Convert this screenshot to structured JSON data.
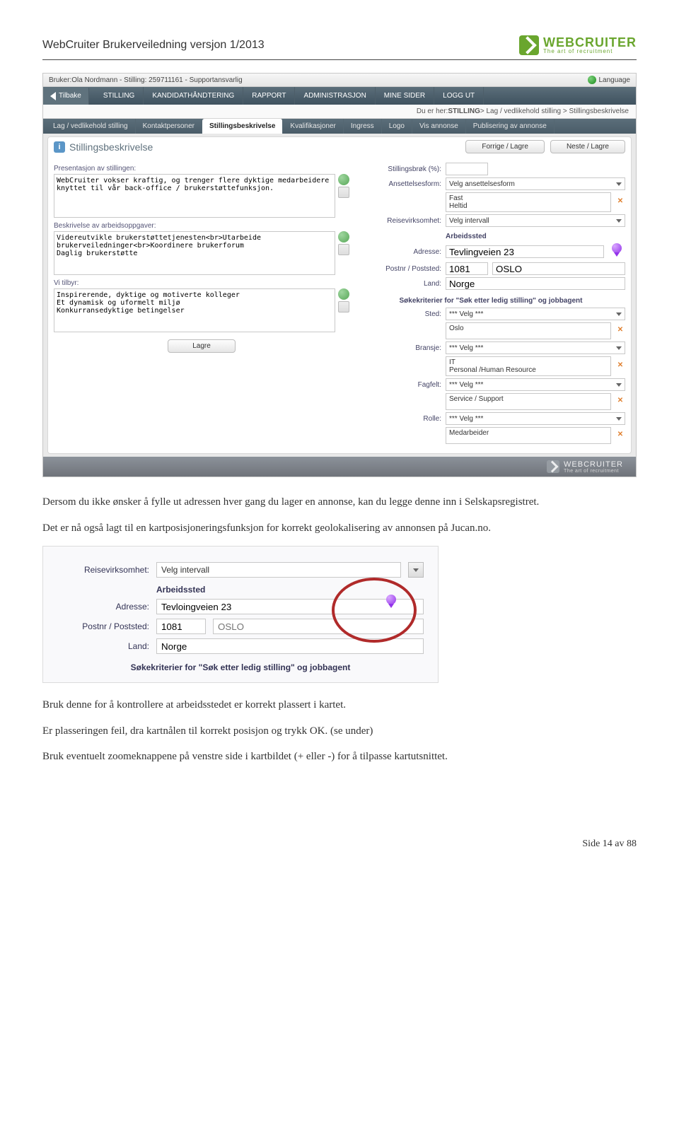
{
  "doc": {
    "title": "WebCruiter Brukerveiledning versjon 1/2013",
    "brand_name": "WEBCRUITER",
    "brand_tagline": "The art of recruitment"
  },
  "app": {
    "user_line": "Bruker:Ola Nordmann - Stilling: 259711161 - Supportansvarlig",
    "language": "Language",
    "back": "Tilbake",
    "nav": [
      "STILLING",
      "KANDIDATHÅNDTERING",
      "RAPPORT",
      "ADMINISTRASJON",
      "MINE SIDER",
      "LOGG UT"
    ],
    "breadcrumb_prefix": "Du er her: ",
    "breadcrumb_bold": "STILLING",
    "breadcrumb_rest": "  >  Lag / vedlikehold stilling  >  Stillingsbeskrivelse",
    "subnav": [
      "Lag / vedlikehold stilling",
      "Kontaktpersoner",
      "Stillingsbeskrivelse",
      "Kvalifikasjoner",
      "Ingress",
      "Logo",
      "Vis annonse",
      "Publisering av annonse"
    ],
    "panel_title": "Stillingsbeskrivelse",
    "btn_prev": "Forrige / Lagre",
    "btn_next": "Neste / Lagre",
    "left": {
      "presentasjon_label": "Presentasjon av stillingen:",
      "presentasjon_value": "WebCruiter vokser kraftig, og trenger flere dyktige medarbeidere knyttet til vår back-office / brukerstøttefunksjon.",
      "beskrivelse_label": "Beskrivelse av arbeidsoppgaver:",
      "beskrivelse_value": "Videreutvikle brukerstøttetjenesten<br>Utarbeide brukerveiledninger<br>Koordinere brukerforum\nDaglig brukerstøtte",
      "tilbyr_label": "Vi tilbyr:",
      "tilbyr_value": "Inspirerende, dyktige og motiverte kolleger\nEt dynamisk og uformelt miljø\nKonkurransedyktige betingelser",
      "lagre": "Lagre"
    },
    "right": {
      "stillingsbrok": "Stillingsbrøk (%):",
      "ansettelsesform": "Ansettelsesform:",
      "ansettelsesform_sel": "Velg ansettelsesform",
      "ansettelsesform_opts": "Fast\nHeltid",
      "reisevirksomhet": "Reisevirksomhet:",
      "reisevirksomhet_sel": "Velg intervall",
      "arbeidssted_head": "Arbeidssted",
      "adresse": "Adresse:",
      "adresse_val": "Tevlingveien 23",
      "postnr": "Postnr / Poststed:",
      "postnr_val": "1081",
      "poststed_val": "OSLO",
      "land": "Land:",
      "land_val": "Norge",
      "sokekriterier": "Søkekriterier for \"Søk etter ledig stilling\" og jobbagent",
      "sted": "Sted:",
      "velg": "*** Velg ***",
      "sted_val": "Oslo",
      "bransje": "Bransje:",
      "bransje_val": "IT\nPersonal /Human Resource",
      "fagfelt": "Fagfelt:",
      "fagfelt_val": "Service / Support",
      "rolle": "Rolle:",
      "rolle_val": "Medarbeider"
    },
    "footer_name": "WEBCRUITER",
    "footer_tag": "The art of recruitment"
  },
  "crop": {
    "reise_label": "Reisevirksomhet:",
    "reise_sel": "Velg intervall",
    "arbeidssted": "Arbeidssted",
    "adresse_label": "Adresse:",
    "adresse_val": "Tevloingveien 23",
    "postnr_label": "Postnr / Poststed:",
    "postnr_val": "1081",
    "poststed_ph": "OSLO",
    "land_label": "Land:",
    "land_val": "Norge",
    "bottom": "Søkekriterier for \"Søk etter ledig stilling\" og jobbagent"
  },
  "body_text": {
    "p1": "Dersom du ikke ønsker å fylle ut adressen hver gang du lager en annonse, kan du legge denne inn i Selskapsregistret.",
    "p2": "Det er nå også lagt til en kartposisjoneringsfunksjon for korrekt geolokalisering av annonsen på Jucan.no.",
    "p3": "Bruk denne for å kontrollere at arbeidsstedet er korrekt plassert i kartet.",
    "p4": "Er plasseringen feil, dra kartnålen til korrekt posisjon og trykk OK. (se under)",
    "p5": "Bruk eventuelt zoomeknappene på venstre side i kartbildet (+ eller -) for å tilpasse kartutsnittet."
  },
  "page_footer": "Side 14 av 88"
}
